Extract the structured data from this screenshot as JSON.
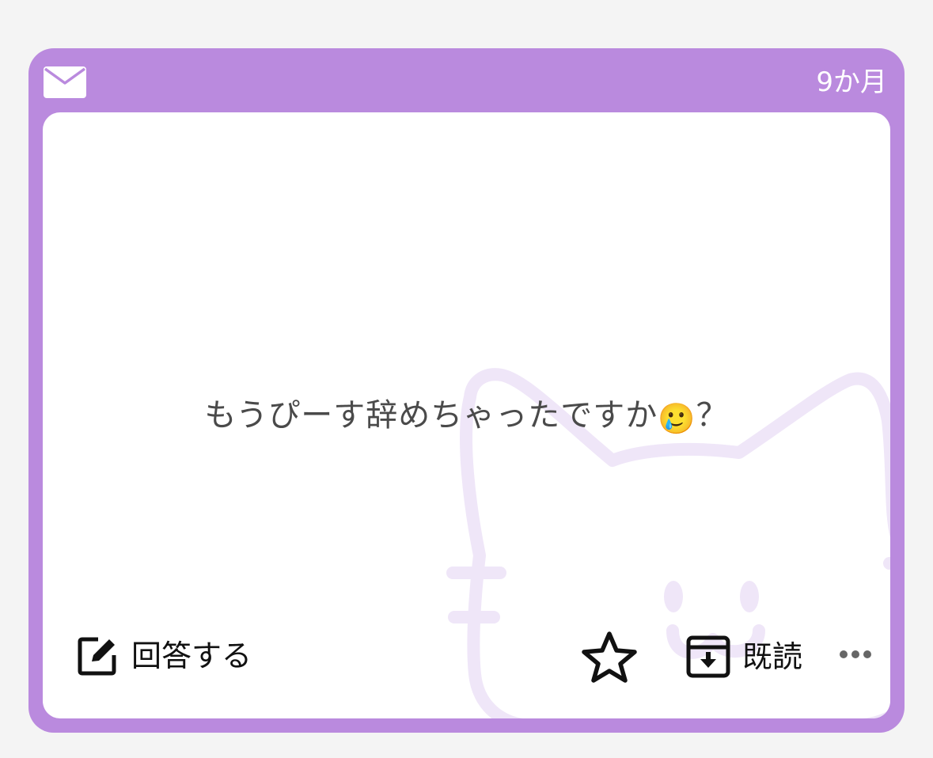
{
  "card": {
    "time_ago": "9か月",
    "question_text": "もうぴーす辞めちゃったですか",
    "question_emoji": "🥲",
    "question_suffix": "？",
    "accent_color": "#ba8ade"
  },
  "actions": {
    "answer_label": "回答する",
    "read_label": "既読"
  },
  "icons": [
    "mail-icon",
    "edit-icon",
    "star-icon",
    "archive-icon",
    "more-icon",
    "cat-illustration"
  ]
}
